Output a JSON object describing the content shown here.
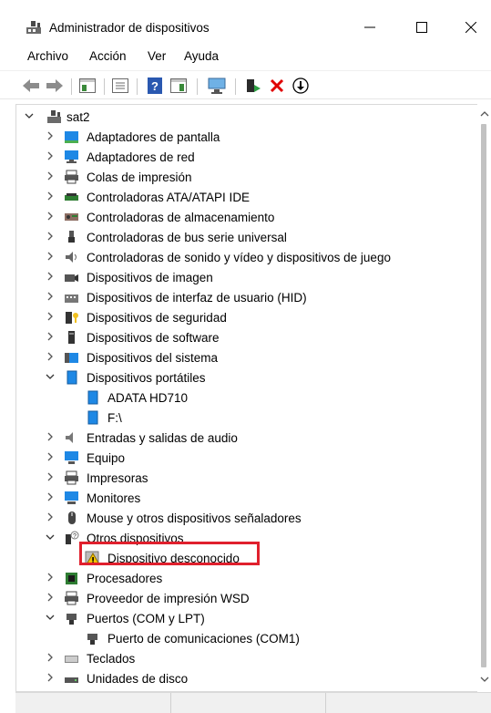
{
  "window": {
    "title": "Administrador de dispositivos"
  },
  "menu": [
    "Archivo",
    "Acción",
    "Ver",
    "Ayuda"
  ],
  "tree": {
    "root": "sat2",
    "items": [
      {
        "label": "Adaptadores de pantalla",
        "icon": "display-adapter-icon"
      },
      {
        "label": "Adaptadores de red",
        "icon": "network-adapter-icon"
      },
      {
        "label": "Colas de impresión",
        "icon": "print-queue-icon"
      },
      {
        "label": "Controladoras ATA/ATAPI IDE",
        "icon": "ide-controller-icon"
      },
      {
        "label": "Controladoras de almacenamiento",
        "icon": "storage-controller-icon"
      },
      {
        "label": "Controladoras de bus serie universal",
        "icon": "usb-icon"
      },
      {
        "label": "Controladoras de sonido y vídeo y dispositivos de juego",
        "icon": "sound-icon"
      },
      {
        "label": "Dispositivos de imagen",
        "icon": "camera-icon"
      },
      {
        "label": "Dispositivos de interfaz de usuario (HID)",
        "icon": "hid-icon"
      },
      {
        "label": "Dispositivos de seguridad",
        "icon": "security-device-icon"
      },
      {
        "label": "Dispositivos de software",
        "icon": "software-device-icon"
      },
      {
        "label": "Dispositivos del sistema",
        "icon": "system-device-icon"
      },
      {
        "label": "Dispositivos portátiles",
        "icon": "portable-device-icon",
        "expanded": true
      },
      {
        "label": "ADATA HD710",
        "icon": "portable-device-icon",
        "child": true
      },
      {
        "label": "F:\\",
        "icon": "portable-device-icon",
        "child": true
      },
      {
        "label": "Entradas y salidas de audio",
        "icon": "audio-io-icon"
      },
      {
        "label": "Equipo",
        "icon": "computer-icon"
      },
      {
        "label": "Impresoras",
        "icon": "printer-icon"
      },
      {
        "label": "Monitores",
        "icon": "monitor-icon"
      },
      {
        "label": "Mouse y otros dispositivos señaladores",
        "icon": "mouse-icon"
      },
      {
        "label": "Otros dispositivos",
        "icon": "other-devices-icon",
        "expanded": true
      },
      {
        "label": "Dispositivo desconocido",
        "icon": "unknown-device-warning-icon",
        "child": true
      },
      {
        "label": "Procesadores",
        "icon": "processor-icon"
      },
      {
        "label": "Proveedor de impresión WSD",
        "icon": "wsd-print-icon"
      },
      {
        "label": "Puertos (COM y LPT)",
        "icon": "port-icon",
        "expanded": true
      },
      {
        "label": "Puerto de comunicaciones (COM1)",
        "icon": "port-icon",
        "child": true
      },
      {
        "label": "Teclados",
        "icon": "keyboard-icon"
      },
      {
        "label": "Unidades de disco",
        "icon": "disk-drive-icon"
      }
    ]
  },
  "colors": {
    "highlight": "#e0202d",
    "device_blue": "#1e88e5",
    "delete_red": "#e00000"
  }
}
